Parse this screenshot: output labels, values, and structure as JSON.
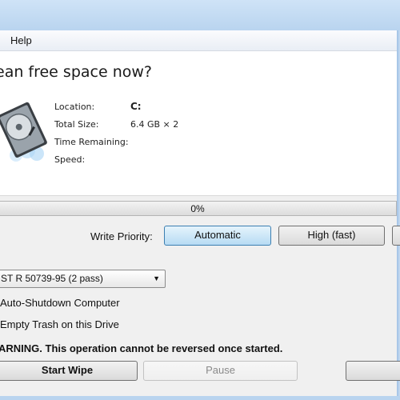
{
  "menu": {
    "help": "Help"
  },
  "heading": "ean free space now?",
  "info": {
    "location_label": "Location:",
    "location_value": "C:",
    "total_size_label": "Total Size:",
    "total_size_value": "6.4 GB × 2",
    "time_remaining_label": "Time Remaining:",
    "speed_label": "Speed:"
  },
  "progress": {
    "value": 0,
    "text": "0%",
    "fill_color": "#37c837"
  },
  "priority": {
    "label": "Write Priority:",
    "options": [
      "Automatic",
      "High (fast)"
    ],
    "selected": "Automatic"
  },
  "method": {
    "selected": "ST R 50739-95 (2 pass)"
  },
  "options": {
    "auto_shutdown": "Auto-Shutdown Computer",
    "empty_trash": "Empty Trash on this Drive"
  },
  "warning": "ARNING. This operation cannot be reversed once started.",
  "buttons": {
    "start_wipe": "Start Wipe",
    "pause": "Pause"
  }
}
